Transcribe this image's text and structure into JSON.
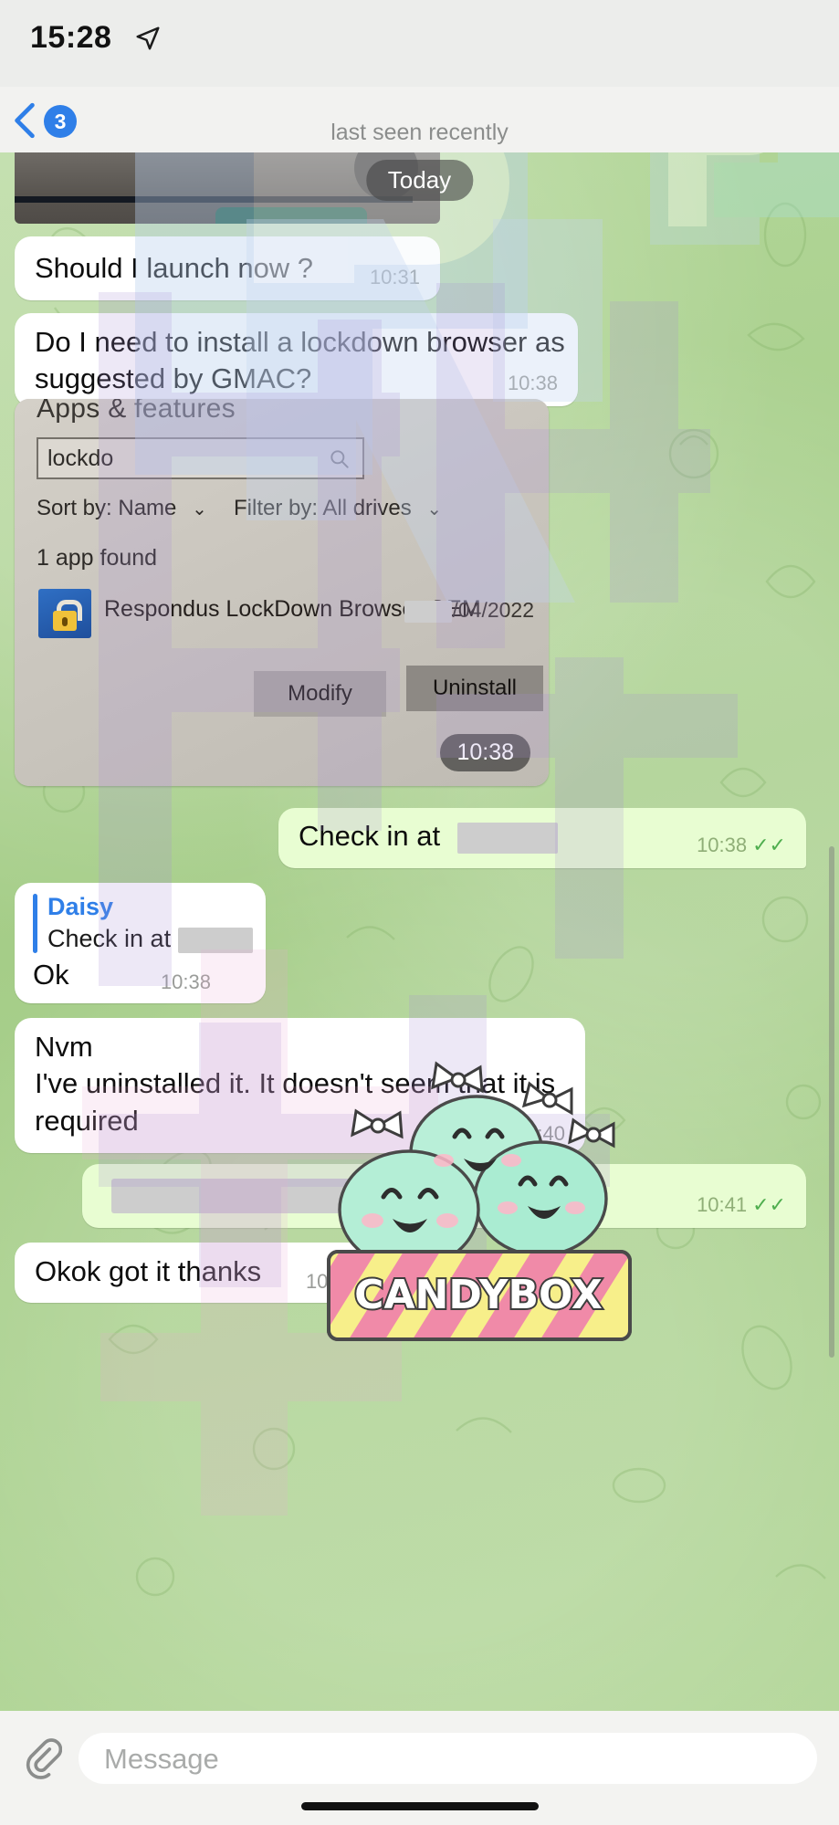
{
  "status_bar": {
    "time": "15:28",
    "location_icon": "location-arrow-icon"
  },
  "header": {
    "back_icon": "chevron-left-icon",
    "unread_badge": "3",
    "title": "",
    "subtitle": "last seen recently"
  },
  "chat": {
    "date_divider": "Today",
    "messages": [
      {
        "id": "photo-partial",
        "type": "photo",
        "direction": "incoming"
      },
      {
        "id": "msg-launch",
        "type": "text",
        "direction": "incoming",
        "text": "Should I launch now ?",
        "time": "10:31"
      },
      {
        "id": "msg-lockdown",
        "type": "text",
        "direction": "incoming",
        "text": "Do I need to install a lockdown browser as suggested by GMAC?",
        "time": "10:38"
      },
      {
        "id": "photo-apps-features",
        "type": "photo",
        "direction": "incoming",
        "time": "10:38",
        "photo_content": {
          "window_title": "Apps & features",
          "search_value": "lockdo",
          "search_icon": "magnifier-icon",
          "sort_by_label": "Sort by:",
          "sort_by_value": "Name",
          "filter_by_label": "Filter by:",
          "filter_by_value": "All drives",
          "result_count": "1 app found",
          "app_icon": "lock-icon",
          "app_name": "Respondus LockDown Browser OEM",
          "install_date": "/04/2022",
          "modify_button": "Modify",
          "uninstall_button": "Uninstall"
        }
      },
      {
        "id": "msg-checkin-out",
        "type": "text",
        "direction": "outgoing",
        "text": "Check in at",
        "redacted": true,
        "time": "10:38",
        "read_ticks": "✓✓"
      },
      {
        "id": "msg-ok",
        "type": "text",
        "direction": "incoming",
        "text": "Ok",
        "time": "10:38",
        "reply_to": {
          "author": "Daisy",
          "text": "Check in at",
          "redacted": true
        }
      },
      {
        "id": "msg-nvm",
        "type": "text",
        "direction": "incoming",
        "text": "Nvm\nI've uninstalled it. It doesn't seem that it is required",
        "time": "10:40"
      },
      {
        "id": "msg-redacted-out",
        "type": "text",
        "direction": "outgoing",
        "text": "",
        "redacted": true,
        "time": "10:41",
        "read_ticks": "✓✓"
      },
      {
        "id": "msg-okok",
        "type": "text",
        "direction": "incoming",
        "text": "Okok got it thanks",
        "time": "10:41"
      }
    ]
  },
  "input_bar": {
    "attach_icon": "paperclip-icon",
    "placeholder": "Message"
  },
  "sticker": {
    "label": "CANDYBOX"
  },
  "colors": {
    "accent_blue": "#2f7fe8",
    "outgoing_bubble": "#e8fdd2",
    "incoming_bubble": "#ffffff",
    "wallpaper_green": "#a8cf8e",
    "tick_green": "#4fae4f"
  }
}
